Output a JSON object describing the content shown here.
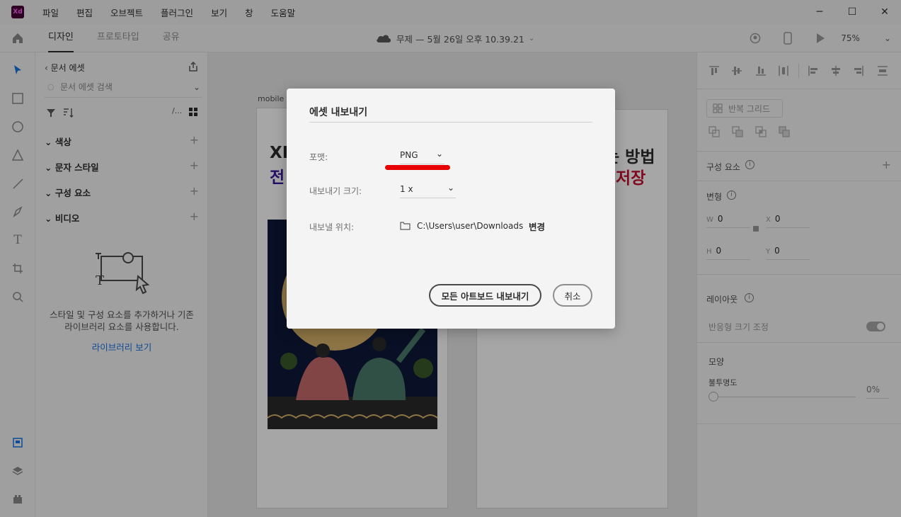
{
  "app": {
    "logo": "Xd"
  },
  "menu": [
    "파일",
    "편집",
    "오브젝트",
    "플러그인",
    "보기",
    "창",
    "도움말"
  ],
  "window_controls": {
    "minimize": "─",
    "maximize": "☐",
    "close": "✕"
  },
  "toolbar": {
    "tabs": [
      {
        "label": "디자인",
        "active": true
      },
      {
        "label": "프로토타입",
        "active": false
      },
      {
        "label": "공유",
        "active": false
      }
    ],
    "document_title": "무제 — 5월 26일 오후 10.39.21",
    "zoom": "75%"
  },
  "assets_panel": {
    "header": "문서 에셋",
    "search_placeholder": "문서 에셋 검색",
    "sections": [
      "색상",
      "문자 스타일",
      "구성 요소",
      "비디오"
    ],
    "empty_text_line1": "스타일 및 구성 요소를 추가하거나 기존",
    "empty_text_line2": "라이브러리 요소를 사용합니다.",
    "library_link": "라이브러리 보기"
  },
  "canvas": {
    "artboard_label": "mobile",
    "left_heading_line1": "XD",
    "left_heading_line2": "전",
    "right_heading_line1": "는 방법",
    "right_heading_line2": "저장"
  },
  "right_panel": {
    "repeat_grid": "반복 그리드",
    "components": "구성 요소",
    "transform": "변형",
    "w_label": "W",
    "w_value": "0",
    "x_label": "X",
    "x_value": "0",
    "h_label": "H",
    "h_value": "0",
    "y_label": "Y",
    "y_value": "0",
    "layout": "레이아웃",
    "responsive_resize": "반응형 크기 조정",
    "appearance": "모양",
    "opacity_label": "불투명도",
    "opacity_value": "0%"
  },
  "dialog": {
    "title": "에셋 내보내기",
    "format_label": "포맷:",
    "format_value": "PNG",
    "size_label": "내보내기 크기:",
    "size_value": "1 x",
    "location_label": "내보낼 위치:",
    "location_path": "C:\\Users\\user\\Downloads",
    "change_label": "변경",
    "export_all_button": "모든 아트보드 내보내기",
    "cancel_button": "취소"
  },
  "colors": {
    "accent_red": "#e60000",
    "link_blue": "#1473e6",
    "heading_purple": "#3a1a9e",
    "heading_red": "#c8102e"
  }
}
